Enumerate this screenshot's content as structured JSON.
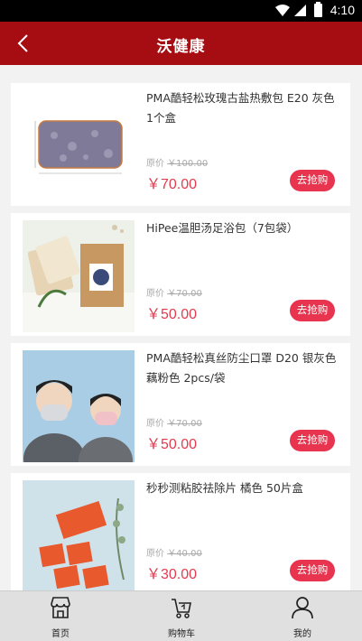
{
  "status_bar": {
    "time": "4:10"
  },
  "header": {
    "title": "沃健康"
  },
  "products": [
    {
      "name": "PMA酷轻松玫瑰古盐热敷包 E20 灰色 1个盒",
      "orig_label": "原价",
      "orig_price": "￥100.00",
      "price": "￥70.00",
      "buy_label": "去抢购"
    },
    {
      "name": "HiPee温胆汤足浴包（7包袋）",
      "orig_label": "原价",
      "orig_price": "￥70.00",
      "price": "￥50.00",
      "buy_label": "去抢购"
    },
    {
      "name": "PMA酷轻松真丝防尘口罩 D20 银灰色 藕粉色 2pcs/袋",
      "orig_label": "原价",
      "orig_price": "￥70.00",
      "price": "￥50.00",
      "buy_label": "去抢购"
    },
    {
      "name": "秒秒测粘胶祛除片 橘色 50片盒",
      "orig_label": "原价",
      "orig_price": "￥40.00",
      "price": "￥30.00",
      "buy_label": "去抢购"
    }
  ],
  "tabbar": [
    {
      "label": "首页",
      "icon": "store-icon"
    },
    {
      "label": "购物车",
      "icon": "cart-icon"
    },
    {
      "label": "我的",
      "icon": "user-icon"
    }
  ],
  "colors": {
    "header_bg": "#a50d12",
    "accent": "#e9344f",
    "price": "#e23b4f"
  }
}
